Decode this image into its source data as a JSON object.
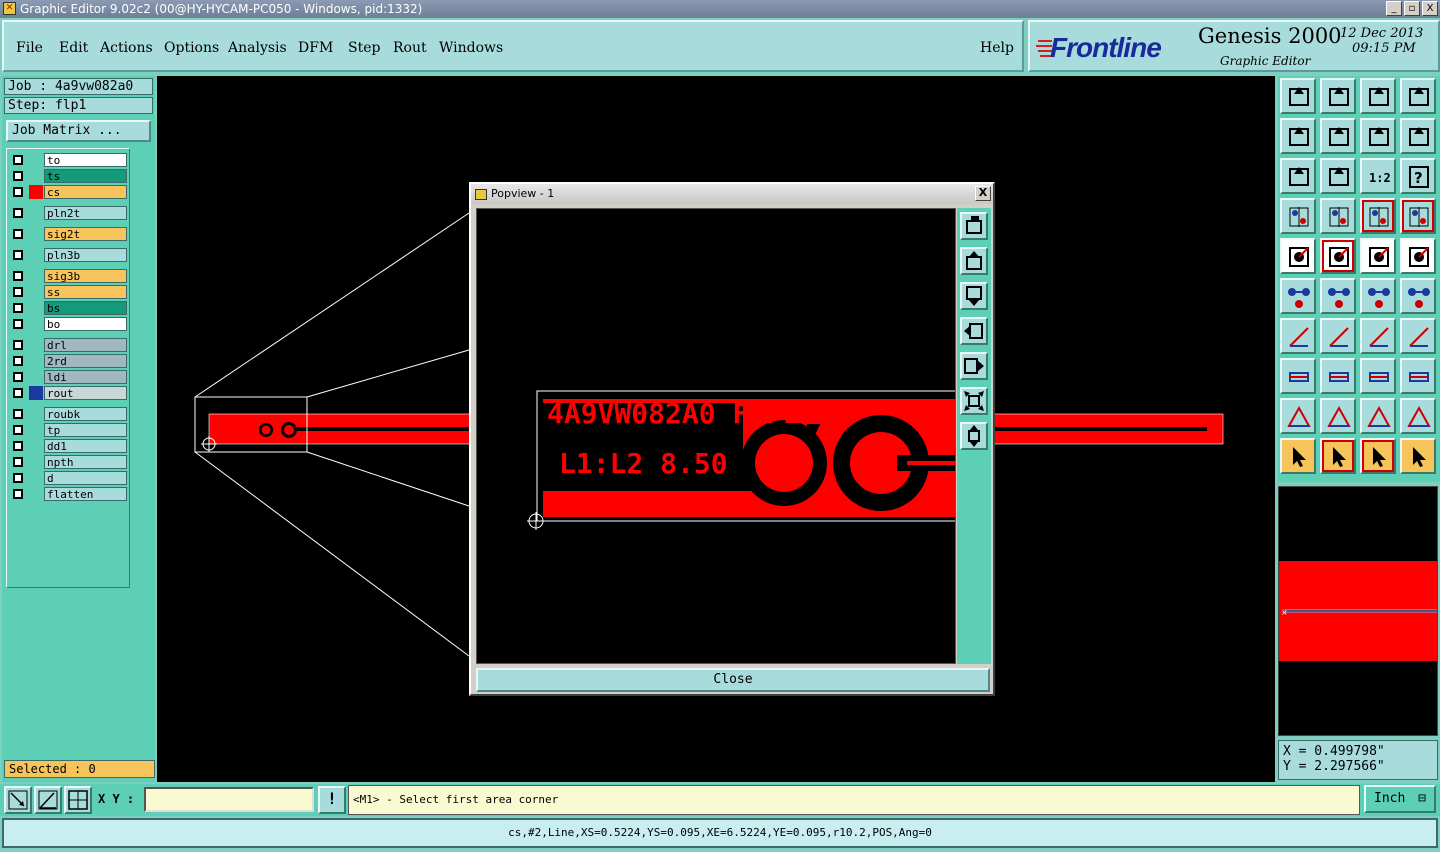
{
  "window": {
    "title": "Graphic Editor 9.02c2 (00@HY-HYCAM-PC050 - Windows, pid:1332)",
    "minimize": "_",
    "maximize": "▫",
    "close": "X"
  },
  "menu": {
    "items": [
      "File",
      "Edit",
      "Actions",
      "Options",
      "Analysis",
      "DFM",
      "Step",
      "Rout",
      "Windows"
    ],
    "help": "Help"
  },
  "brand": {
    "logo": "Frontline",
    "product": "Genesis 2000",
    "subtitle": "Graphic Editor",
    "date": "12 Dec 2013",
    "time": "09:15 PM"
  },
  "job": {
    "job_line": "Job : 4a9vw082a0",
    "step_line": "Step: flp1",
    "matrix_button": "Job Matrix ..."
  },
  "layers": [
    {
      "name": "to",
      "color": "#ffffff",
      "mark": "",
      "group": 0
    },
    {
      "name": "ts",
      "color": "#129a7a",
      "mark": "",
      "group": 0
    },
    {
      "name": "cs",
      "color": "#f6c45a",
      "mark": "#ff0000",
      "group": 0
    },
    {
      "name": "pln2t",
      "color": "#a8dcdc",
      "mark": "",
      "group": 1
    },
    {
      "name": "sig2t",
      "color": "#f6c45a",
      "mark": "",
      "group": 2
    },
    {
      "name": "pln3b",
      "color": "#a8dcdc",
      "mark": "",
      "group": 3
    },
    {
      "name": "sig3b",
      "color": "#f6c45a",
      "mark": "",
      "group": 4
    },
    {
      "name": "ss",
      "color": "#f6c45a",
      "mark": "",
      "group": 4
    },
    {
      "name": "bs",
      "color": "#129a7a",
      "mark": "",
      "group": 4
    },
    {
      "name": "bo",
      "color": "#ffffff",
      "mark": "",
      "group": 4
    },
    {
      "name": "drl",
      "color": "#a0b8c0",
      "mark": "",
      "group": 5
    },
    {
      "name": "2rd",
      "color": "#a0b8c0",
      "mark": "",
      "group": 5
    },
    {
      "name": "ldi",
      "color": "#a0b8c0",
      "mark": "",
      "group": 5
    },
    {
      "name": "rout",
      "color": "#c8d8d8",
      "mark": "#1a3aa0",
      "group": 5
    },
    {
      "name": "roubk",
      "color": "#a8dcdc",
      "mark": "",
      "group": 6
    },
    {
      "name": "tp",
      "color": "#a8dcdc",
      "mark": "",
      "group": 6
    },
    {
      "name": "dd1",
      "color": "#a8dcdc",
      "mark": "",
      "group": 6
    },
    {
      "name": "npth",
      "color": "#a8dcdc",
      "mark": "",
      "group": 6
    },
    {
      "name": "d",
      "color": "#a8dcdc",
      "mark": "",
      "group": 6
    },
    {
      "name": "flatten",
      "color": "#a8dcdc",
      "mark": "",
      "group": 6
    }
  ],
  "selected": "Selected : 0",
  "popview": {
    "title": "Popview - 1",
    "text_line1": "4A9VW082A0 FLP1",
    "text_line2": "L1:L2 8.50",
    "close_button": "Close",
    "close_x": "X"
  },
  "board": {
    "small_text1": "4A9VW082A0 FLP1",
    "small_text2": "L1:L2 8.50"
  },
  "coords": {
    "x": "X = 0.499798\"",
    "y": "Y = 2.297566\""
  },
  "bottom": {
    "xy_label": "X Y :",
    "xy_value": "",
    "message": "<M1> - Select first area corner",
    "unit": "Inch",
    "warn_icon": "!"
  },
  "status": "cs,#2,Line,XS=0.5224,YS=0.095,XE=6.5224,YE=0.095,r10.2,POS,Ang=0",
  "colors": {
    "copper": "#ff0000",
    "canvas": "#000000",
    "panel": "#5ccfb4",
    "button": "#a8dcdc"
  }
}
